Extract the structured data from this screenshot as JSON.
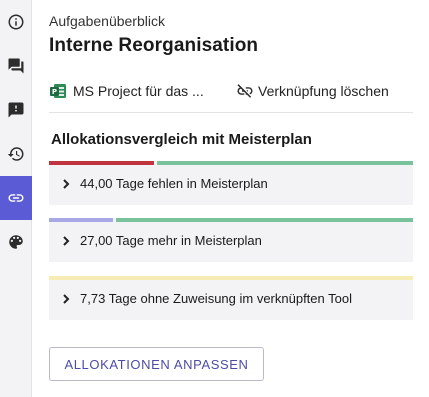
{
  "sidebar": {
    "items": [
      {
        "icon": "info-icon",
        "active": false
      },
      {
        "icon": "forum-icon",
        "active": false
      },
      {
        "icon": "feedback-icon",
        "active": false
      },
      {
        "icon": "history-icon",
        "active": false
      },
      {
        "icon": "link-icon",
        "active": true
      },
      {
        "icon": "palette-icon",
        "active": false
      }
    ]
  },
  "header": {
    "overline": "Aufgabenüberblick",
    "title": "Interne Reorganisation"
  },
  "linked_project": {
    "icon": "ms-project-icon",
    "label": "MS Project für das ...",
    "unlink_icon": "link-off-icon",
    "unlink_label": "Verknüpfung löschen"
  },
  "comparison": {
    "title": "Allokationsvergleich mit Meisterplan",
    "items": [
      {
        "label": "44,00 Tage fehlen in Meisterplan",
        "bar": [
          {
            "fraction": 0.29,
            "color": "#c0343f"
          },
          {
            "fraction": 0.71,
            "color": "#79c39c"
          }
        ]
      },
      {
        "label": "27,00 Tage mehr in Meisterplan",
        "bar": [
          {
            "fraction": 0.18,
            "color": "#a8a8e6"
          },
          {
            "fraction": 0.82,
            "color": "#79c39c"
          }
        ]
      },
      {
        "label": "7,73 Tage ohne Zuweisung im verknüpften Tool",
        "bar": [
          {
            "fraction": 1.0,
            "color": "#f7ecb4"
          }
        ]
      }
    ]
  },
  "actions": {
    "adjust_label": "ALLOKATIONEN ANPASSEN"
  }
}
